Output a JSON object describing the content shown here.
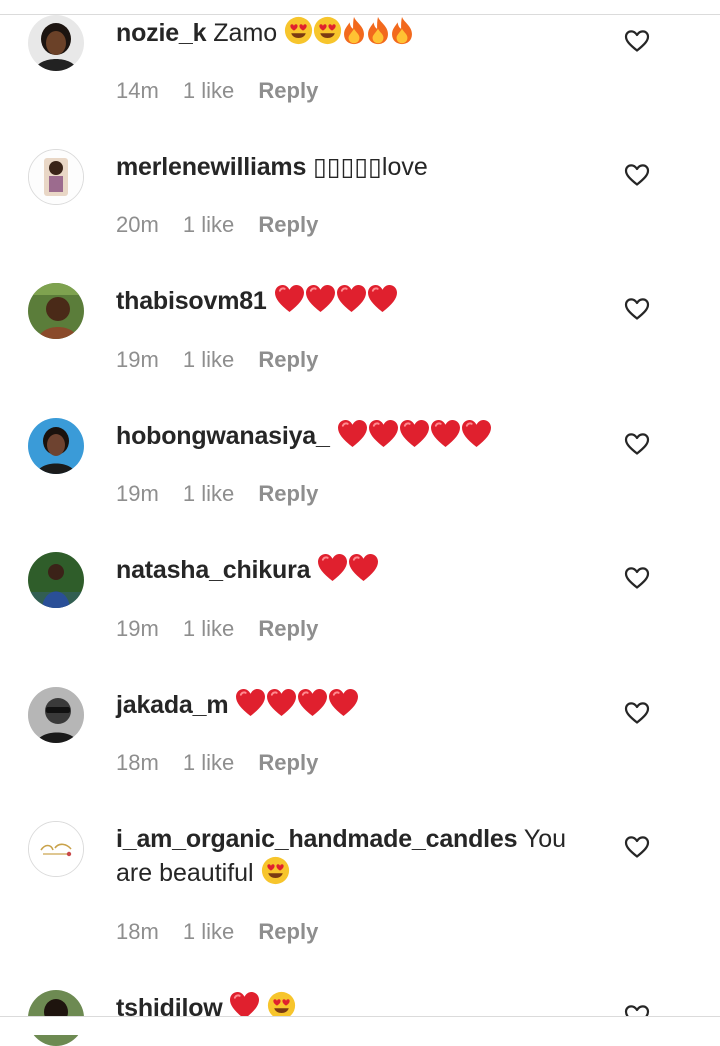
{
  "comments": [
    {
      "username": "nozie_k",
      "text": "Zamo",
      "emoji": [
        "heart-eyes",
        "heart-eyes",
        "fire",
        "fire",
        "fire"
      ],
      "time": "14m",
      "likes": "1 like",
      "reply": "Reply"
    },
    {
      "username": "merlenewilliams",
      "text": "▯▯▯▯▯love",
      "emoji": [],
      "time": "20m",
      "likes": "1 like",
      "reply": "Reply"
    },
    {
      "username": "thabisovm81",
      "text": "",
      "emoji": [
        "red-heart",
        "red-heart",
        "red-heart",
        "red-heart"
      ],
      "time": "19m",
      "likes": "1 like",
      "reply": "Reply"
    },
    {
      "username": "hobongwanasiya_",
      "text": "",
      "emoji": [
        "red-heart",
        "red-heart",
        "red-heart",
        "red-heart",
        "red-heart"
      ],
      "time": "19m",
      "likes": "1 like",
      "reply": "Reply"
    },
    {
      "username": "natasha_chikura",
      "text": "",
      "emoji": [
        "red-heart",
        "red-heart"
      ],
      "time": "19m",
      "likes": "1 like",
      "reply": "Reply"
    },
    {
      "username": "jakada_m",
      "text": "",
      "emoji": [
        "red-heart",
        "red-heart",
        "red-heart",
        "red-heart"
      ],
      "time": "18m",
      "likes": "1 like",
      "reply": "Reply"
    },
    {
      "username": "i_am_organic_handmade_candles",
      "text": "You are beautiful",
      "emoji": [
        "heart-eyes"
      ],
      "time": "18m",
      "likes": "1 like",
      "reply": "Reply"
    },
    {
      "username": "tshidilow",
      "text": "",
      "emoji": [
        "red-heart",
        "heart-eyes"
      ],
      "time": "",
      "likes": "",
      "reply": ""
    }
  ],
  "icons": {
    "like": "heart-outline-icon",
    "avatar": "avatar-image"
  },
  "colors": {
    "text": "#262626",
    "meta": "#8e8e8e",
    "divider": "#dbdbdb",
    "heart_red": "#e0202e",
    "emoji_yellow": "#f7c52c",
    "fire_orange": "#f2691d"
  }
}
